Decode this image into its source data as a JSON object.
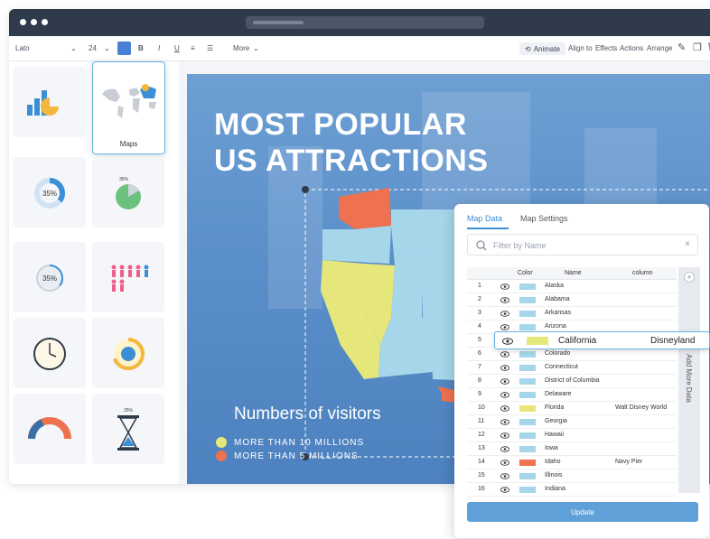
{
  "toolbar": {
    "font": "Lato",
    "font_size": "24",
    "bold": "B",
    "italic": "I",
    "underline": "U",
    "more": "More",
    "animate": "Animate",
    "align_to": "Align to",
    "effects": "Effects",
    "actions": "Actions",
    "arrange": "Arrange"
  },
  "sidebar": {
    "maps_label": "Maps",
    "donut_value": "35%",
    "pie_value": "35%",
    "gauge_value": "35%",
    "hourglass_value": "25%"
  },
  "canvas": {
    "title_line1": "MOST POPULAR",
    "title_line2": "US ATTRACTIONS",
    "legend_title": "Numbers of visitors",
    "legend_item1": "MORE THAN 10 MILLIONS",
    "legend_item2": "MORE THAN 5 MILLIONS",
    "color_yellow": "#e6e77a",
    "color_orange": "#ee7150",
    "color_lightblue": "#a6d6ea"
  },
  "panel": {
    "tab_map_data": "Map Data",
    "tab_map_settings": "Map Settings",
    "filter_placeholder": "Filter by Name",
    "col_color": "Color",
    "col_name": "Name",
    "col_column": "column",
    "add_more_data": "Add More Data",
    "update": "Update",
    "rows": [
      {
        "num": "1",
        "name": "Alaska",
        "value": "",
        "color": "#a6d6ea"
      },
      {
        "num": "2",
        "name": "Alabama",
        "value": "",
        "color": "#a6d6ea"
      },
      {
        "num": "3",
        "name": "Arkansas",
        "value": "",
        "color": "#a6d6ea"
      },
      {
        "num": "4",
        "name": "Arizona",
        "value": "",
        "color": "#a6d6ea"
      },
      {
        "num": "5",
        "name": "California",
        "value": "Disneyland",
        "color": "#e6e77a"
      },
      {
        "num": "6",
        "name": "Colorado",
        "value": "",
        "color": "#a6d6ea"
      },
      {
        "num": "7",
        "name": "Connecticut",
        "value": "",
        "color": "#a6d6ea"
      },
      {
        "num": "8",
        "name": "District of Columbia",
        "value": "",
        "color": "#a6d6ea"
      },
      {
        "num": "9",
        "name": "Delaware",
        "value": "",
        "color": "#a6d6ea"
      },
      {
        "num": "10",
        "name": "Florida",
        "value": "Walt Disney World",
        "color": "#e6e77a"
      },
      {
        "num": "11",
        "name": "Georgia",
        "value": "",
        "color": "#a6d6ea"
      },
      {
        "num": "12",
        "name": "Hawaii",
        "value": "",
        "color": "#a6d6ea"
      },
      {
        "num": "13",
        "name": "Iowa",
        "value": "",
        "color": "#a6d6ea"
      },
      {
        "num": "14",
        "name": "Idaho",
        "value": "Navy Pier",
        "color": "#ee7150"
      },
      {
        "num": "15",
        "name": "Illinois",
        "value": "",
        "color": "#a6d6ea"
      },
      {
        "num": "16",
        "name": "Indiana",
        "value": "",
        "color": "#a6d6ea"
      }
    ]
  }
}
